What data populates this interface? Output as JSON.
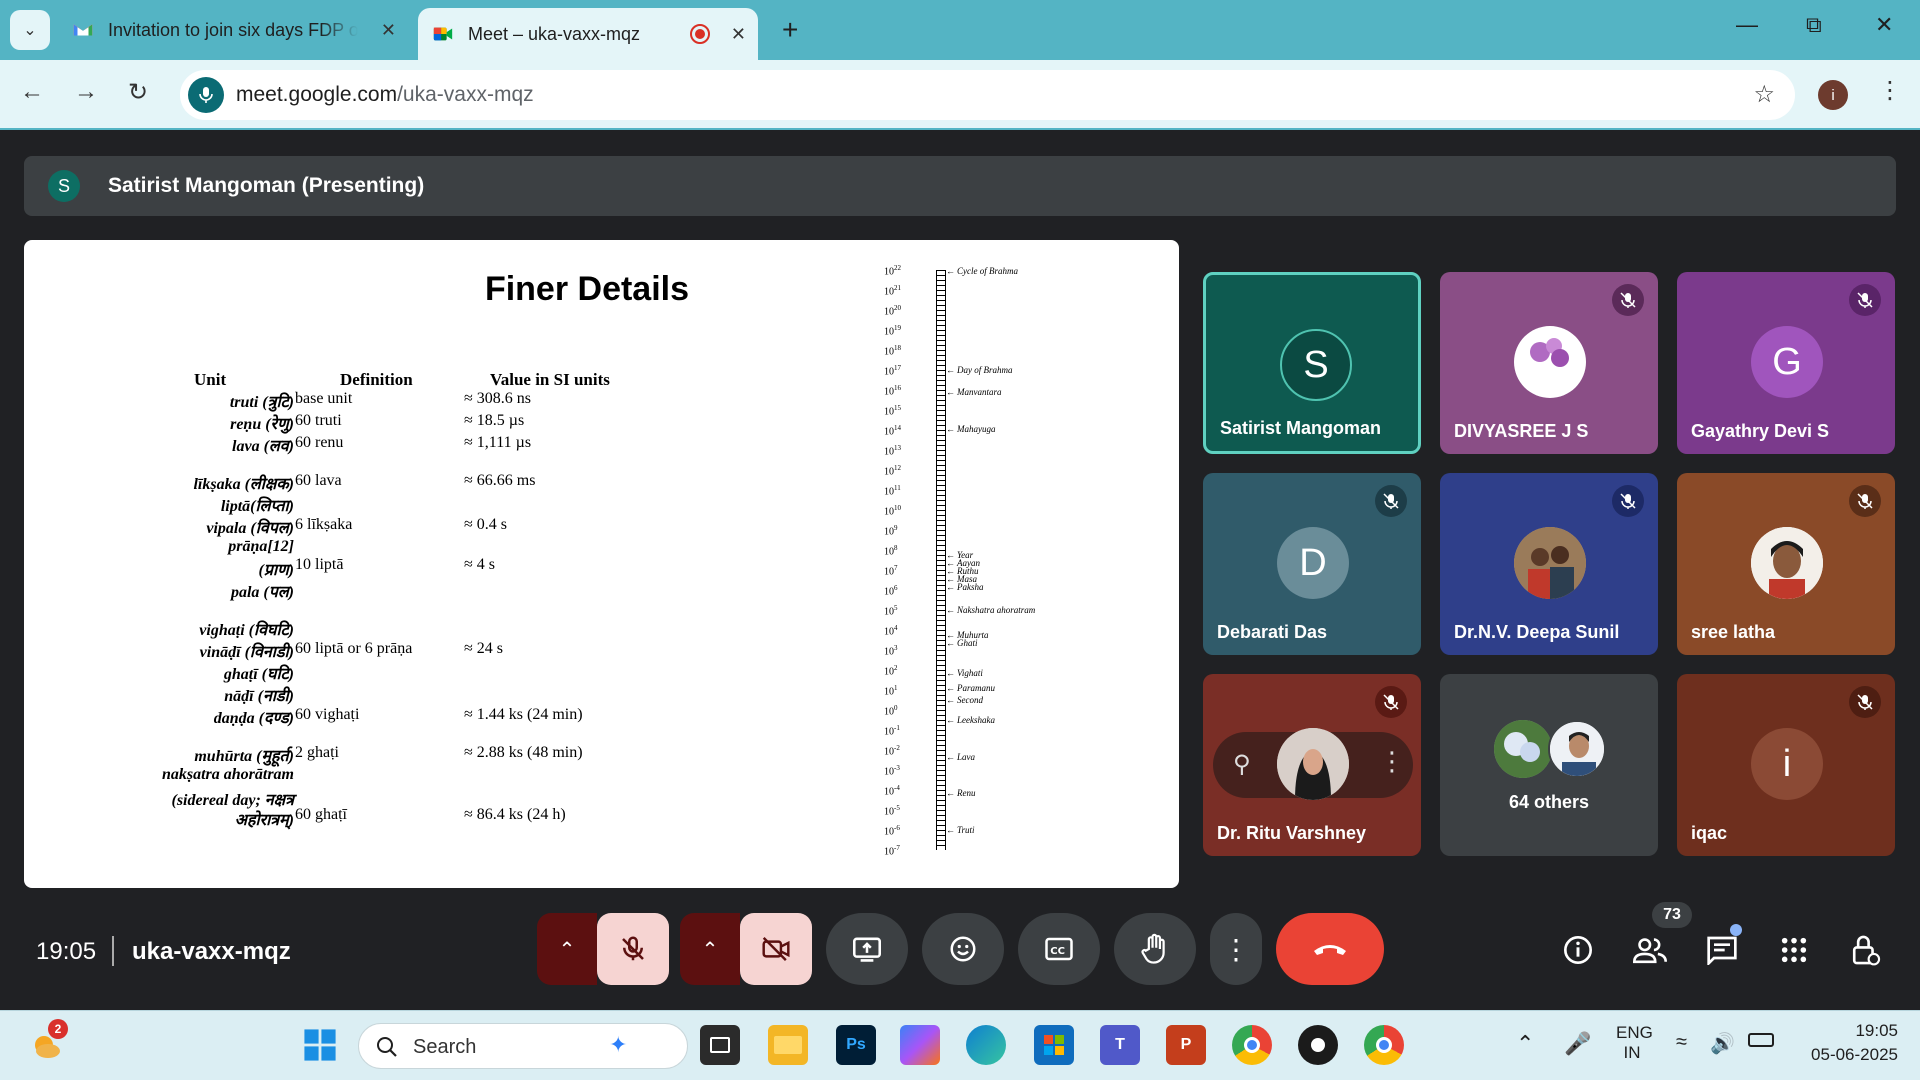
{
  "browser": {
    "tabs": [
      {
        "title": "Invitation to join six days FDP on"
      },
      {
        "title": "Meet – uka-vaxx-mqz"
      }
    ],
    "url_host": "meet.google.com",
    "url_path": "/uka-vaxx-mqz",
    "profile_initial": "i"
  },
  "meet": {
    "presenter_initial": "S",
    "presenter_label": "Satirist Mangoman (Presenting)",
    "time": "19:05",
    "code": "uka-vaxx-mqz",
    "participant_count": "73",
    "participants": [
      {
        "name": "Satirist Mangoman",
        "initial": "S"
      },
      {
        "name": "DIVYASREE J S",
        "initial": ""
      },
      {
        "name": "Gayathry Devi S",
        "initial": "G"
      },
      {
        "name": "Debarati Das",
        "initial": "D"
      },
      {
        "name": "Dr.N.V. Deepa Sunil",
        "initial": ""
      },
      {
        "name": "sree latha",
        "initial": ""
      },
      {
        "name": "Dr. Ritu Varshney",
        "initial": ""
      },
      {
        "name": "64 others",
        "initial": ""
      },
      {
        "name": "iqac",
        "initial": "i"
      }
    ]
  },
  "slide": {
    "title": "Finer Details",
    "headers": [
      "Unit",
      "Definition",
      "Value in SI units"
    ],
    "units": [
      "truti (त्रुटि)",
      "reṇu (रेणु)",
      "lava (लव)",
      "līkṣaka (लीक्षक)",
      "liptā(लिप्ता)",
      "vipala (विपल)",
      "prāṇa[12]",
      "(प्राण)",
      "pala (पल)",
      "vighaṭi (विघटि)",
      "vināḍī (विनाडी)",
      "ghaṭī (घटि)",
      "nāḍī (नाडी)",
      "daṇḍa (दण्ड)",
      "muhūrta (मुहूर्त)",
      "nakṣatra ahorātram",
      "(sidereal day; नक्षत्र",
      "अहोरात्रम्)"
    ],
    "definitions": [
      "base unit",
      "60 truti",
      "60 renu",
      "60 lava",
      "6 līkṣaka",
      "10 liptā",
      "60 liptā or 6 prāṇa",
      "60 vighaṭi",
      "2 ghaṭi",
      "60 ghaṭī"
    ],
    "values": [
      "≈ 308.6 ns",
      "≈ 18.5 µs",
      "≈ 1,111 µs",
      "≈ 66.66 ms",
      "≈ 0.4 s",
      "≈ 4 s",
      "≈ 24 s",
      "≈ 1.44 ks (24 min)",
      "≈ 2.88 ks (48 min)",
      "≈ 86.4 ks (24 h)"
    ],
    "scale_base": "10",
    "scale_exponents": [
      "22",
      "21",
      "20",
      "19",
      "18",
      "17",
      "16",
      "15",
      "14",
      "13",
      "12",
      "11",
      "10",
      "9",
      "8",
      "7",
      "6",
      "5",
      "4",
      "3",
      "2",
      "1",
      "0",
      "-1",
      "-2",
      "-3",
      "-4",
      "-5",
      "-6",
      "-7"
    ],
    "scale_marks": [
      "Cycle of Brahma",
      "Day of Brahma",
      "Manvantara",
      "Mahayuga",
      "Year",
      "Aayan",
      "Ruthu",
      "Masa",
      "Paksha",
      "Nakshatra ahoratram",
      "Muhurta",
      "Ghati",
      "Vighati",
      "Paramanu",
      "Second",
      "Leekshaka",
      "Lava",
      "Renu",
      "Truti"
    ]
  },
  "taskbar": {
    "notification_count": "2",
    "search_placeholder": "Search",
    "lang_line1": "ENG",
    "lang_line2": "IN",
    "clock_time": "19:05",
    "clock_date": "05-06-2025"
  },
  "colors": {
    "tab_strip": "#54b4c4",
    "meet_bg": "#202124",
    "end_call": "#ea4335",
    "muted_bg": "#f6d4d2",
    "muted_split": "#5c1010"
  }
}
